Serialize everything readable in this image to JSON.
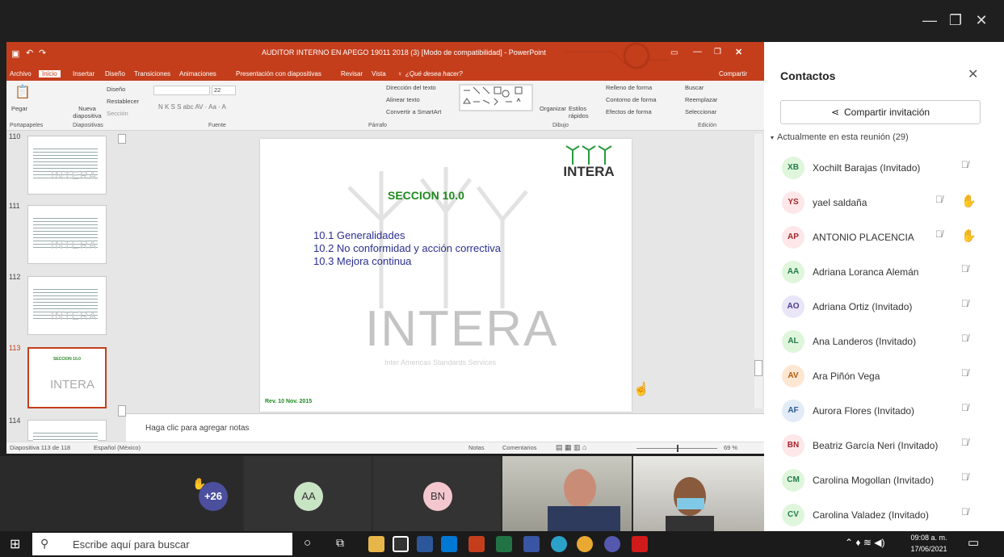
{
  "window": {
    "minimize": "—",
    "restore": "❐",
    "close": "✕"
  },
  "ppt": {
    "title": "AUDITOR INTERNO EN APEGO 19011 2018 (3) [Modo de compatibilidad] - PowerPoint",
    "tabs": [
      "Archivo",
      "Inicio",
      "Insertar",
      "Diseño",
      "Transiciones",
      "Animaciones",
      "Presentación con diapositivas",
      "Revisar",
      "Vista"
    ],
    "tell_me": "¿Qué desea hacer?",
    "share": "Compartir",
    "ribbon_groups": [
      "Portapapeles",
      "Diapositivas",
      "Fuente",
      "Párrafo",
      "Dibujo",
      "Edición"
    ],
    "ribbon_buttons": {
      "paste": "Pegar",
      "new_slide": "Nueva diapositiva",
      "layout": "Diseño",
      "reset": "Restablecer",
      "section": "Sección",
      "font_size": "22",
      "text_direction": "Dirección del texto",
      "align_text": "Alinear texto",
      "smartart": "Convertir a SmartArt",
      "arrange": "Organizar",
      "quick_styles": "Estilos rápidos",
      "fill": "Relleno de forma",
      "outline": "Contorno de forma",
      "effects": "Efectos de forma",
      "find": "Buscar",
      "replace": "Reemplazar",
      "select": "Seleccionar"
    },
    "thumbs": [
      {
        "num": "110"
      },
      {
        "num": "111"
      },
      {
        "num": "112"
      },
      {
        "num": "113",
        "selected": true
      },
      {
        "num": "114"
      }
    ],
    "slide": {
      "heading": "SECCION 10.0",
      "items": [
        "10.1  Generalidades",
        "10.2  No conformidad y acción correctiva",
        "10.3  Mejora continua"
      ],
      "watermark": "INTERA",
      "watermark_sub": "Inter Americas Standards Services",
      "logo": "INTERA",
      "footer": "Rev. 10  Nov. 2015"
    },
    "notes_placeholder": "Haga clic para agregar notas",
    "status_left": "Diapositiva 113 de 118",
    "status_lang": "Español (México)",
    "status_notes": "Notas",
    "status_comments": "Comentarios",
    "zoom": "69 %"
  },
  "contacts": {
    "title": "Contactos",
    "share_invite": "Compartir invitación",
    "meeting_header": "Actualmente en esta reunión (29)",
    "people": [
      {
        "initials": "XB",
        "name": "Xochilt Barajas (Invitado)",
        "bg": "#dff6dd",
        "fg": "#237b4b",
        "hand": false
      },
      {
        "initials": "YS",
        "name": "yael saldaña",
        "bg": "#fde7e9",
        "fg": "#a4262c",
        "hand": true
      },
      {
        "initials": "AP",
        "name": "ANTONIO PLACENCIA",
        "bg": "#fde7e9",
        "fg": "#a4262c",
        "hand": true
      },
      {
        "initials": "AA",
        "name": "Adriana Loranca Alemán",
        "bg": "#dff6dd",
        "fg": "#237b4b",
        "hand": false
      },
      {
        "initials": "AO",
        "name": "Adriana Ortiz (Invitado)",
        "bg": "#e8e6f7",
        "fg": "#4f3c91",
        "hand": false
      },
      {
        "initials": "AL",
        "name": "Ana Landeros (Invitado)",
        "bg": "#dff6dd",
        "fg": "#237b4b",
        "hand": false
      },
      {
        "initials": "AV",
        "name": "Ara Piñón Vega",
        "bg": "#fde7d3",
        "fg": "#b35a07",
        "hand": false
      },
      {
        "initials": "AF",
        "name": "Aurora Flores (Invitado)",
        "bg": "#e3ebf6",
        "fg": "#2b5d9a",
        "hand": false
      },
      {
        "initials": "BN",
        "name": "Beatriz García Neri (Invitado)",
        "bg": "#fde7e9",
        "fg": "#a4262c",
        "hand": false
      },
      {
        "initials": "CM",
        "name": "Carolina Mogollan (Invitado)",
        "bg": "#dff6dd",
        "fg": "#237b4b",
        "hand": false
      },
      {
        "initials": "CV",
        "name": "Carolina Valadez (Invitado)",
        "bg": "#dff6dd",
        "fg": "#237b4b",
        "hand": false
      }
    ]
  },
  "video": {
    "overflow": "+26",
    "tile_aa": "AA",
    "tile_bn": "BN"
  },
  "taskbar": {
    "search": "Escribe aquí para buscar",
    "time": "09:08 a. m.",
    "date": "17/06/2021"
  }
}
